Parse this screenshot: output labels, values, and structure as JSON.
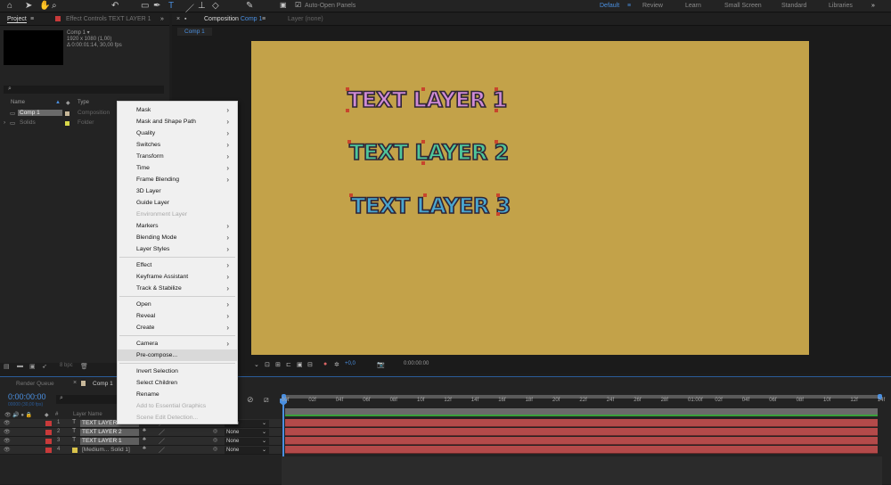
{
  "toolbar": {
    "auto_open_label": "Auto-Open Panels",
    "workspaces": [
      "Default",
      "Review",
      "Learn",
      "Small Screen",
      "Standard",
      "Libraries"
    ],
    "active_workspace": "Default",
    "more": "»"
  },
  "project_panel": {
    "tab": "Project",
    "effect_controls_tab": "Effect Controls TEXT LAYER 1",
    "comp_name": "Comp 1 ▾",
    "comp_size": "1920 x 1080 (1,00)",
    "comp_duration": "Δ 0:00:01:14, 30,00 fps",
    "search_icon": "⌕",
    "columns": {
      "name": "Name",
      "type": "Type"
    },
    "items": [
      {
        "name": "Comp 1",
        "type": "Composition",
        "color": "#c8b89a"
      },
      {
        "name": "Solids",
        "type": "Folder",
        "color": "#d8d84a"
      }
    ],
    "bottom_bpc": "8 bpc"
  },
  "viewer": {
    "tab_prefix": "Composition",
    "tab_comp": "Comp 1",
    "layer_tab": "Layer (none)",
    "breadcrumb": "Comp 1",
    "exposure": "+0,0",
    "time": "0:00:00:00",
    "bg_color": "#c3a249",
    "texts": [
      {
        "label": "TEXT LAYER 1",
        "color": "#cf8bd6"
      },
      {
        "label": "TEXT LAYER 2",
        "color": "#4fc59a"
      },
      {
        "label": "TEXT LAYER 3",
        "color": "#4aa6cf"
      }
    ]
  },
  "context_menu": {
    "groups": [
      [
        {
          "label": "Mask",
          "sub": true
        },
        {
          "label": "Mask and Shape Path",
          "sub": true
        },
        {
          "label": "Quality",
          "sub": true
        },
        {
          "label": "Switches",
          "sub": true
        },
        {
          "label": "Transform",
          "sub": true
        },
        {
          "label": "Time",
          "sub": true
        },
        {
          "label": "Frame Blending",
          "sub": true
        },
        {
          "label": "3D Layer"
        },
        {
          "label": "Guide Layer"
        },
        {
          "label": "Environment Layer",
          "disabled": true
        },
        {
          "label": "Markers",
          "sub": true
        },
        {
          "label": "Blending Mode",
          "sub": true
        },
        {
          "label": "Layer Styles",
          "sub": true
        }
      ],
      [
        {
          "label": "Effect",
          "sub": true
        },
        {
          "label": "Keyframe Assistant",
          "sub": true
        },
        {
          "label": "Track & Stabilize",
          "sub": true
        }
      ],
      [
        {
          "label": "Open",
          "sub": true
        },
        {
          "label": "Reveal",
          "sub": true
        },
        {
          "label": "Create",
          "sub": true
        }
      ],
      [
        {
          "label": "Camera",
          "sub": true
        },
        {
          "label": "Pre-compose...",
          "hover": true
        }
      ],
      [
        {
          "label": "Invert Selection"
        },
        {
          "label": "Select Children"
        },
        {
          "label": "Rename"
        },
        {
          "label": "Add to Essential Graphics",
          "disabled": true
        },
        {
          "label": "Scene Edit Detection...",
          "disabled": true
        }
      ]
    ]
  },
  "timeline": {
    "render_queue_tab": "Render Queue",
    "comp_tab": "Comp 1",
    "timecode": "0:00:00:00",
    "fps_sub": "00000 (30,00 fps)",
    "col_layer_name": "Layer Name",
    "col_num": "#",
    "layers": [
      {
        "num": "1",
        "name": "TEXT LAYER 1",
        "mode": "None"
      },
      {
        "num": "2",
        "name": "TEXT LAYER 2",
        "mode": "None"
      },
      {
        "num": "3",
        "name": "TEXT LAYER 1",
        "mode": "None"
      },
      {
        "num": "4",
        "name": "[Medium... Solid 1]",
        "mode": "None"
      }
    ],
    "ticks": [
      "00f",
      "02f",
      "04f",
      "06f",
      "08f",
      "10f",
      "12f",
      "14f",
      "16f",
      "18f",
      "20f",
      "22f",
      "24f",
      "26f",
      "28f",
      "01:00f",
      "02f",
      "04f",
      "06f",
      "08f",
      "10f",
      "12f",
      "14f"
    ]
  }
}
